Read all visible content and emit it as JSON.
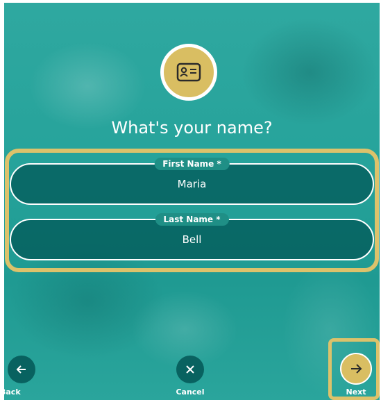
{
  "page": {
    "title": "What's your name?"
  },
  "form": {
    "first_name": {
      "label": "First Name *",
      "value": "Maria"
    },
    "last_name": {
      "label": "Last Name *",
      "value": "Bell"
    }
  },
  "nav": {
    "back_label": "Back",
    "cancel_label": "Cancel",
    "next_label": "Next"
  },
  "icons": {
    "top": "id-card-icon",
    "back": "arrow-left-icon",
    "cancel": "close-icon",
    "next": "arrow-right-icon"
  },
  "colors": {
    "background": "#26a39b",
    "accent_gold": "#d9be62",
    "field_fill": "#005555",
    "text": "#ffffff"
  }
}
